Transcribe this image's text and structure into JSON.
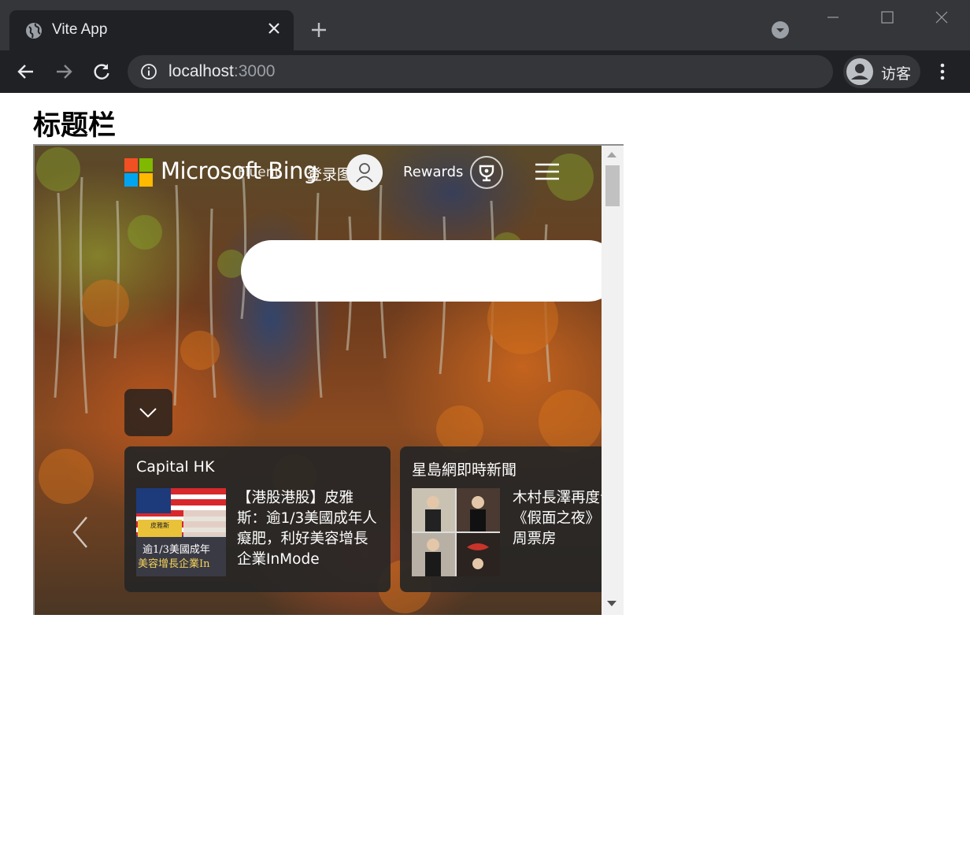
{
  "browser": {
    "tab_title": "Vite App",
    "url_host": "localhost",
    "url_port": ":3000",
    "profile_name": "访客"
  },
  "page": {
    "heading": "标题栏"
  },
  "bing": {
    "brand": "Microsoft Bing",
    "overlap_text": "Fluent",
    "signin": "登录图",
    "rewards": "Rewards",
    "cards": [
      {
        "source": "Capital HK",
        "headline": "【港股港股】皮雅斯：逾1/3美國成年人癡肥，利好美容增長企業InMode",
        "thumb_caption_top": "皮雅斯",
        "thumb_caption_mid": "逾1/3美國成年",
        "thumb_caption_bottom": "美容增長企業In"
      },
      {
        "source": "星島網即時新聞",
        "headline": "木村長澤再度合兇《假面之夜》日本兩周票房"
      }
    ]
  },
  "colors": {
    "chrome_dark": "#202124",
    "chrome_titlebar": "#35363a",
    "ms_red": "#f25022",
    "ms_green": "#7fba00",
    "ms_blue": "#00a4ef",
    "ms_yellow": "#ffb900"
  },
  "icons": [
    "globe-icon",
    "close-icon",
    "plus-icon",
    "back-icon",
    "forward-icon",
    "reload-icon",
    "info-icon",
    "avatar-icon",
    "kebab-menu-icon",
    "user-icon",
    "trophy-icon",
    "hamburger-icon",
    "chevron-down-icon",
    "chevron-left-icon"
  ]
}
